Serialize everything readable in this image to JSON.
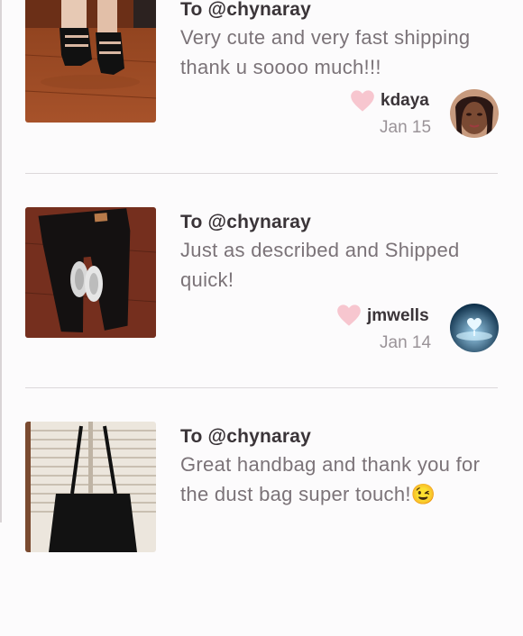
{
  "reviews": [
    {
      "to": "To @chynaray",
      "message": "Very cute and very fast shipping thank u soooo much!!!",
      "username": "kdaya",
      "date": "Jan 15",
      "image": "black-strappy-heels-photo",
      "avatar": "woman-portrait-avatar"
    },
    {
      "to": "To @chynaray",
      "message": "Just as described and Shipped quick!",
      "username": "jmwells",
      "date": "Jan 14",
      "image": "black-jeans-and-sneakers-photo",
      "avatar": "blue-water-heart-avatar"
    },
    {
      "to": "To @chynaray",
      "message": "Great handbag and thank you for the dust bag super touch!😉",
      "image": "black-handbag-photo"
    }
  ],
  "colors": {
    "heart": "#f7c6cf",
    "username": "#3a3438",
    "message": "#7b7378",
    "date": "#9a9398",
    "divider": "#dcd8da"
  },
  "icons": {
    "like": "heart-icon"
  }
}
